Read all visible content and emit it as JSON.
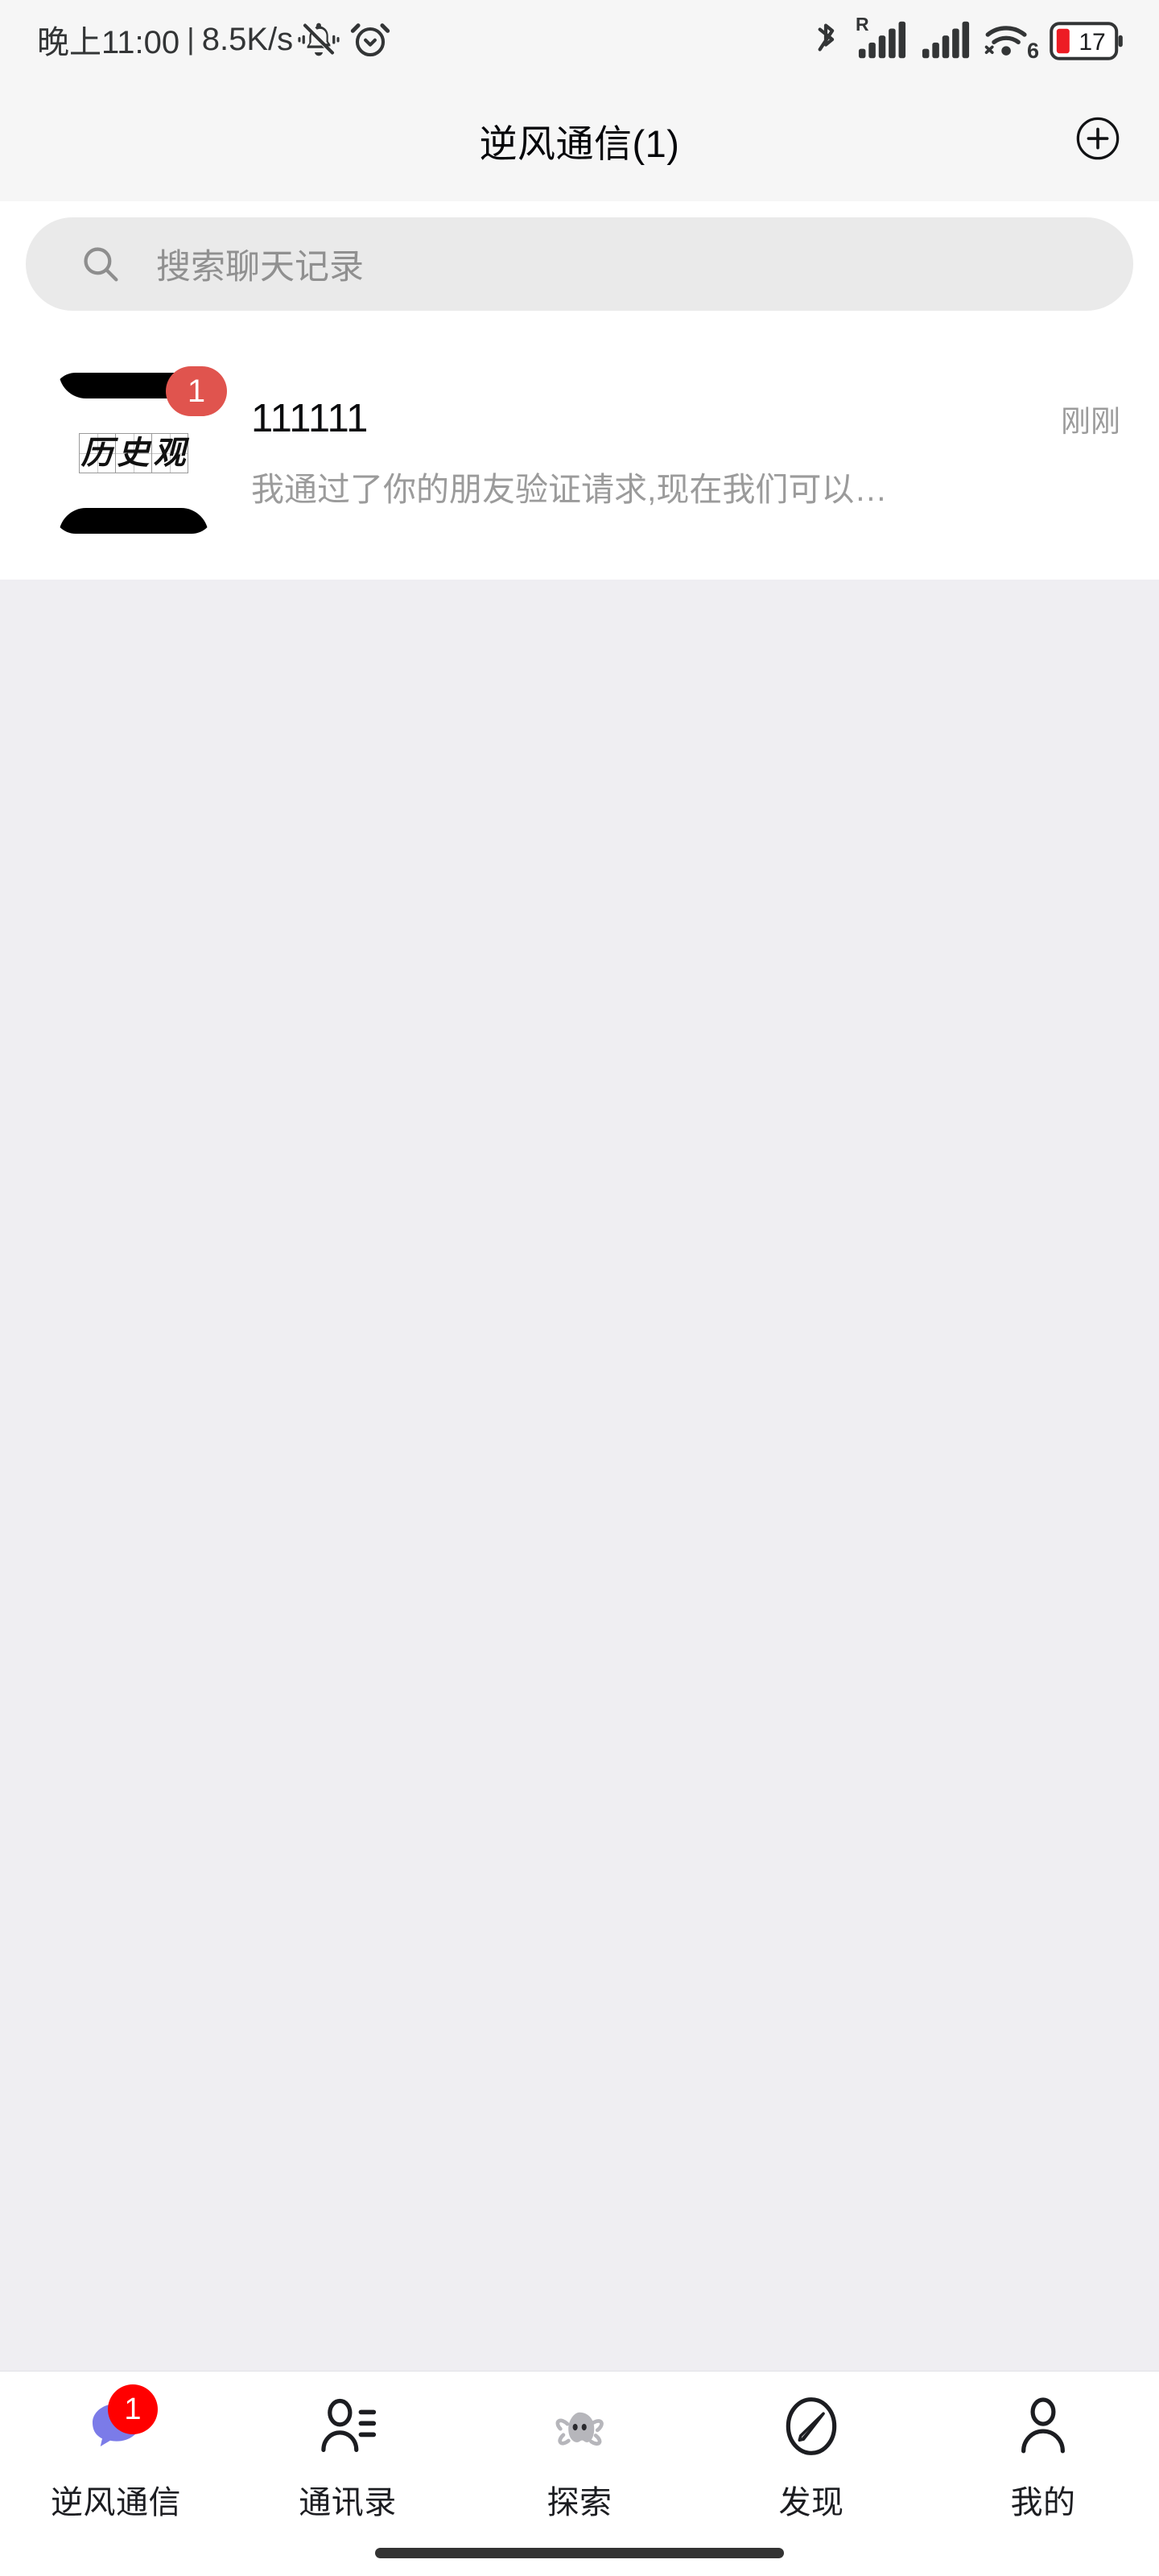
{
  "status_bar": {
    "time": "晚上11:00",
    "separator": "|",
    "net_speed": "8.5K/s",
    "mute_icon": "bell-mute-icon",
    "alarm_icon": "alarm-clock-icon",
    "bluetooth_icon": "bluetooth-icon",
    "sim1_label": "R",
    "sim1_icon": "signal-bars-icon",
    "sim2_icon": "signal-bars-icon",
    "wifi_icon": "wifi-icon",
    "wifi_generation": "6",
    "battery_level": "17",
    "battery_icon": "battery-icon",
    "battery_color": "#ED1C24"
  },
  "header": {
    "title": "逆风通信(1)",
    "add_button_icon": "plus-circle-icon"
  },
  "search": {
    "icon": "search-icon",
    "placeholder": "搜索聊天记录",
    "value": ""
  },
  "chats": [
    {
      "avatar_text": "历史观",
      "avatar_chars": [
        "历",
        "史",
        "观"
      ],
      "badge": "1",
      "badge_color": "#E0544E",
      "name": "111111",
      "time": "刚刚",
      "preview": "我通过了你的朋友验证请求,现在我们可以…"
    }
  ],
  "tabs": [
    {
      "label": "逆风通信",
      "icon": "chat-bubble-icon",
      "badge": "1",
      "active": true,
      "icon_color": "#7B7BE8",
      "badge_color": "#FF0000"
    },
    {
      "label": "通讯录",
      "icon": "contacts-icon",
      "badge": "",
      "active": false,
      "icon_color": "#1c1d21",
      "badge_color": ""
    },
    {
      "label": "探索",
      "icon": "ghost-icon",
      "badge": "",
      "active": false,
      "icon_color": "#A9A9AD",
      "badge_color": ""
    },
    {
      "label": "发现",
      "icon": "compass-icon",
      "badge": "",
      "active": false,
      "icon_color": "#1c1d21",
      "badge_color": ""
    },
    {
      "label": "我的",
      "icon": "person-icon",
      "badge": "",
      "active": false,
      "icon_color": "#1c1d21",
      "badge_color": ""
    }
  ],
  "colors": {
    "page_background": "#EFEEF2",
    "header_background": "#F6F6F6",
    "card_background": "#FFFFFF",
    "search_field": "#EAEAEA",
    "muted_text": "#9B9B9B",
    "primary_text": "#0A0B0D"
  }
}
